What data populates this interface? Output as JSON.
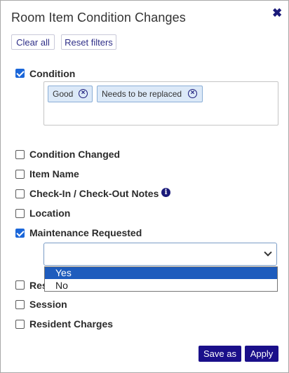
{
  "dialog": {
    "title": "Room Item Condition Changes",
    "close_glyph": "✖"
  },
  "actions_top": {
    "clear_all": "Clear all",
    "reset_filters": "Reset filters"
  },
  "filters": [
    {
      "label": "Condition",
      "checked": true
    },
    {
      "label": "Condition Changed",
      "checked": false
    },
    {
      "label": "Item Name",
      "checked": false
    },
    {
      "label": "Check-In / Check-Out Notes",
      "checked": false
    },
    {
      "label": "Location",
      "checked": false
    },
    {
      "label": "Maintenance Requested",
      "checked": true
    },
    {
      "label": "Res",
      "checked": false
    },
    {
      "label": "Session",
      "checked": false
    },
    {
      "label": "Resident Charges",
      "checked": false
    }
  ],
  "condition_tags": [
    "Good",
    "Needs to be replaced"
  ],
  "tag_remove_glyph": "×",
  "info_glyph": "i",
  "maintenance_select": {
    "value": "",
    "options": [
      "Yes",
      "No"
    ],
    "highlighted": "Yes"
  },
  "actions_bottom": {
    "save_as": "Save as",
    "apply": "Apply"
  },
  "colors": {
    "accent": "#1a0f8a",
    "checkbox": "#1a66d9",
    "tag_bg": "#dce9f8",
    "option_highlight": "#1e5cbd"
  },
  "icons": {
    "close": "close-icon",
    "tag_remove": "remove-tag-icon",
    "info": "info-icon",
    "chevron": "chevron-down-icon"
  }
}
